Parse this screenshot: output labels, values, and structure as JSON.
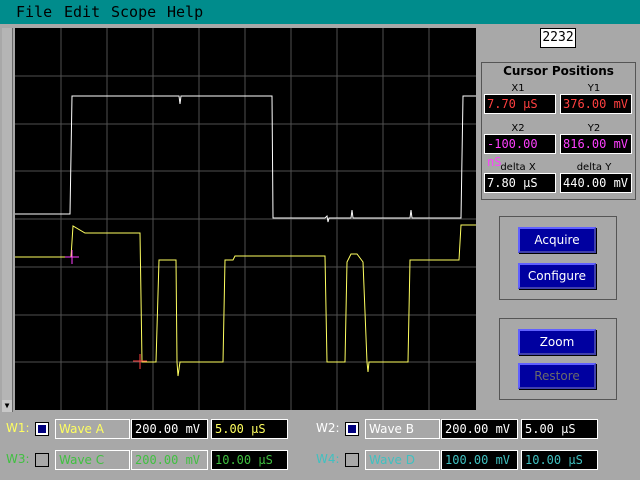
{
  "menu": {
    "items": [
      "File",
      "Edit",
      "Scope",
      "Help"
    ]
  },
  "counter": "2232",
  "cursor_panel": {
    "title": "Cursor Positions",
    "x1_label": "X1",
    "x1_value": "7.70 µS",
    "y1_label": "Y1",
    "y1_value": "376.00 mV",
    "x2_label": "X2",
    "x2_value": "-100.00 nS",
    "y2_label": "Y2",
    "y2_value": "816.00 mV",
    "dx_label": "delta X",
    "dx_value": "7.80 µS",
    "dy_label": "delta Y",
    "dy_value": "440.00 mV"
  },
  "buttons": {
    "acquire": "Acquire",
    "configure": "Configure",
    "zoom": "Zoom",
    "restore": "Restore"
  },
  "waves": [
    {
      "label": "W1:",
      "name": "Wave A",
      "volts": "200.00 mV",
      "time": "5.00 µS",
      "enabled": true,
      "color": "#ffff60",
      "name_color": "#ffff60"
    },
    {
      "label": "W2:",
      "name": "Wave B",
      "volts": "200.00 mV",
      "time": "5.00 µS",
      "enabled": true,
      "color": "#ffffff",
      "name_color": "#ffffff"
    },
    {
      "label": "W3:",
      "name": "Wave C",
      "volts": "200.00 mV",
      "time": "10.00 µS",
      "enabled": false,
      "color": "#40c040",
      "name_color": "#40c040"
    },
    {
      "label": "W4:",
      "name": "Wave D",
      "volts": "100.00 mV",
      "time": "10.00 µS",
      "enabled": false,
      "color": "#40c0c0",
      "name_color": "#40c0c0"
    }
  ],
  "colors": {
    "menubar": "#008c8c",
    "cursor_x1_y1": "#ff4040",
    "cursor_x2_y2": "#ff40ff",
    "trace_white": "#ffffff",
    "trace_yellow": "#ffff60",
    "button": "#0000a0"
  }
}
